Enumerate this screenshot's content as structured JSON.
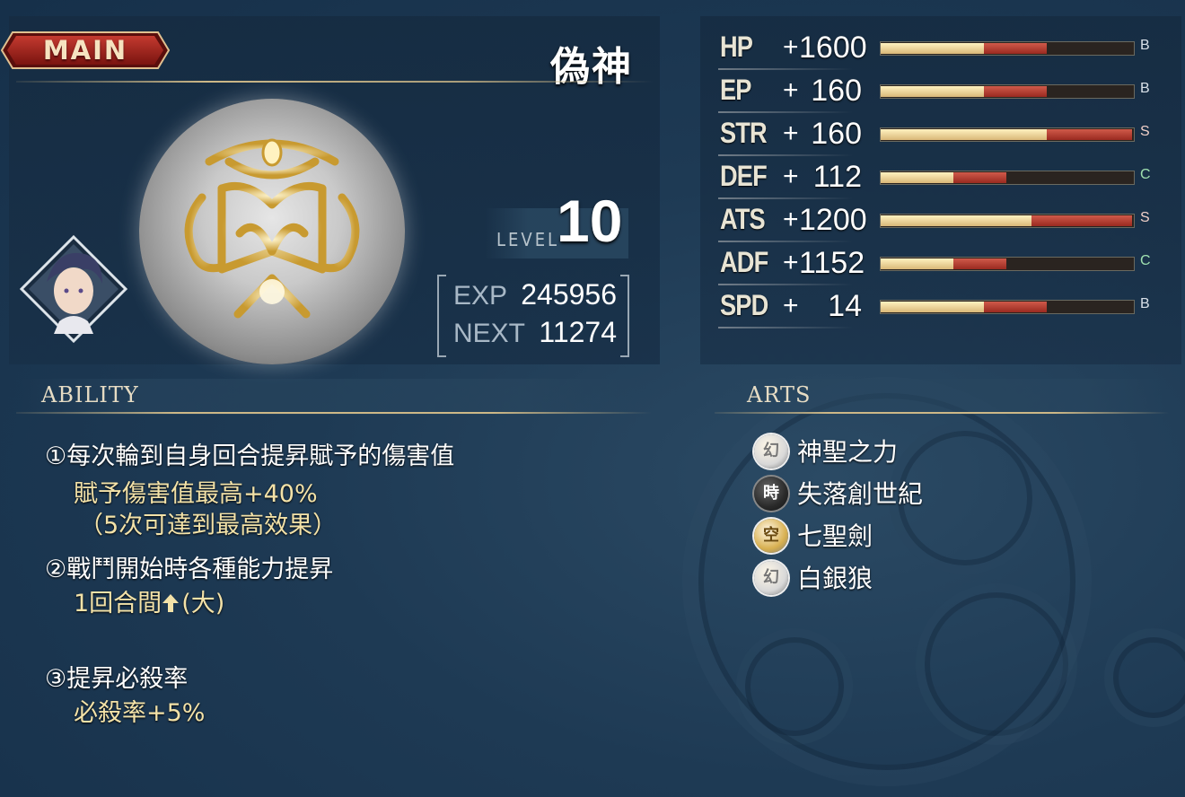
{
  "header": {
    "tag": "MAIN",
    "name": "偽神"
  },
  "level": {
    "label": "LEVEL",
    "value": "10"
  },
  "exp": {
    "exp_label": "EXP",
    "exp_value": "245956",
    "next_label": "NEXT",
    "next_value": "11274"
  },
  "stats": [
    {
      "name": "HP",
      "plus": "+",
      "value": "1600",
      "gold": 0.41,
      "red": 0.66,
      "grade": "B",
      "grade_color": "#d8e0e8"
    },
    {
      "name": "EP",
      "plus": "+",
      "value": "160",
      "gold": 0.41,
      "red": 0.66,
      "grade": "B",
      "grade_color": "#d8e0e8"
    },
    {
      "name": "STR",
      "plus": "+",
      "value": "160",
      "gold": 0.66,
      "red": 1.0,
      "grade": "S",
      "grade_color": "#f0d0c8"
    },
    {
      "name": "DEF",
      "plus": "+",
      "value": "112",
      "gold": 0.29,
      "red": 0.5,
      "grade": "C",
      "grade_color": "#9fe0b0"
    },
    {
      "name": "ATS",
      "plus": "+",
      "value": "1200",
      "gold": 0.6,
      "red": 1.0,
      "grade": "S",
      "grade_color": "#f0d0c8"
    },
    {
      "name": "ADF",
      "plus": "+",
      "value": "1152",
      "gold": 0.29,
      "red": 0.5,
      "grade": "C",
      "grade_color": "#9fe0b0"
    },
    {
      "name": "SPD",
      "plus": "+",
      "value": "14",
      "gold": 0.41,
      "red": 0.66,
      "grade": "B",
      "grade_color": "#d8e0e8"
    }
  ],
  "ability": {
    "title": "ABILITY",
    "lines": [
      "①每次輪到自身回合提昇賦予的傷害值",
      "賦予傷害值最高+40%",
      "（5次可達到最高效果）",
      "②戰鬥開始時各種能力提昇",
      "1回合間",
      "(大)",
      "③提昇必殺率",
      "必殺率+5%"
    ]
  },
  "arts": {
    "title": "ARTS",
    "items": [
      {
        "icon": "幻",
        "icon_name": "illusion-element-icon",
        "label": "神聖之力",
        "color": "#d8d8d8"
      },
      {
        "icon": "時",
        "icon_name": "time-element-icon",
        "label": "失落創世紀",
        "color": "#2a2a2a"
      },
      {
        "icon": "空",
        "icon_name": "space-element-icon",
        "label": "七聖劍",
        "color": "#d8b050"
      },
      {
        "icon": "幻",
        "icon_name": "illusion-element-icon",
        "label": "白銀狼",
        "color": "#d8d8d8"
      }
    ]
  }
}
